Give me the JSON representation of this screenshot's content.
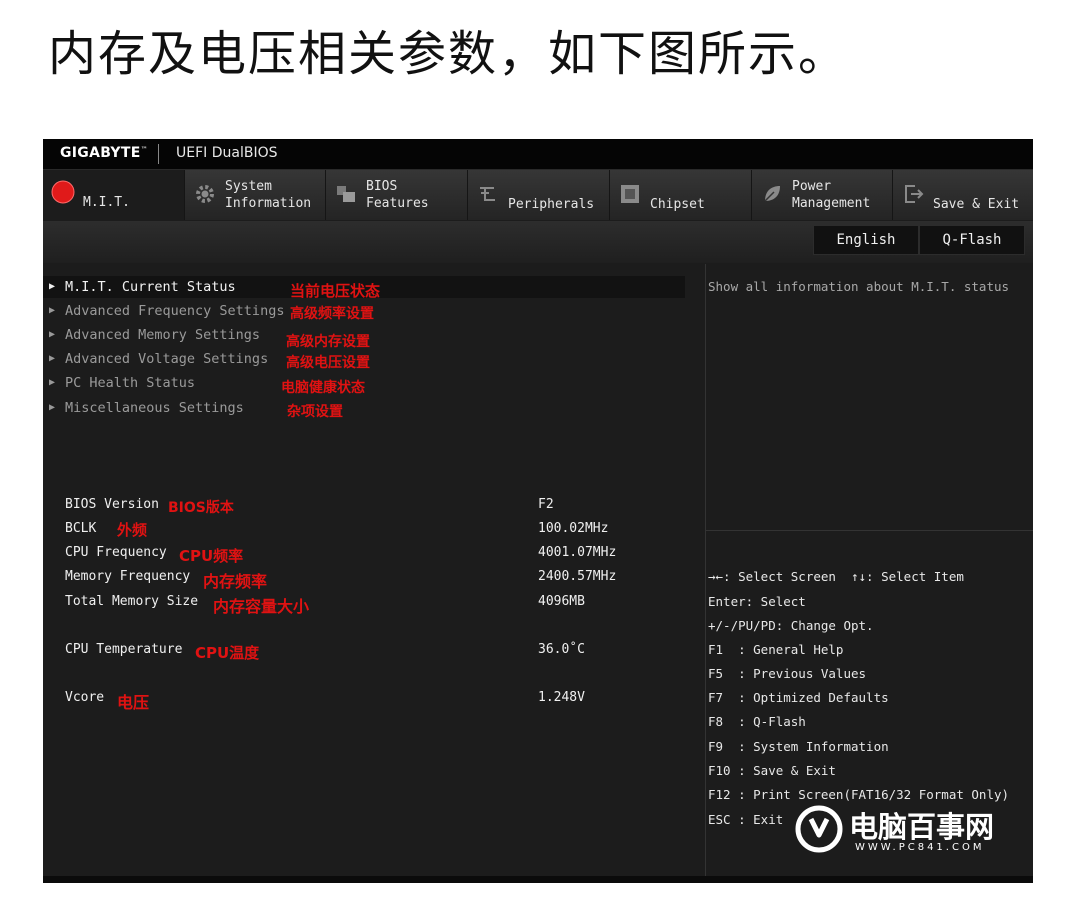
{
  "heading": "内存及电压相关参数，如下图所示。",
  "bios": {
    "brand": "GIGABYTE",
    "brand_mark": "™",
    "product": "UEFI DualBIOS",
    "tabs": [
      {
        "label": "M.I.T.",
        "icon": "mit-dot-icon",
        "active": true
      },
      {
        "label": "System\nInformation",
        "icon": "gear-icon"
      },
      {
        "label": "BIOS\nFeatures",
        "icon": "bios-features-icon"
      },
      {
        "label": "Peripherals",
        "icon": "peripherals-icon"
      },
      {
        "label": "Chipset",
        "icon": "chip-icon"
      },
      {
        "label": "Power\nManagement",
        "icon": "power-leaf-icon"
      },
      {
        "label": "Save & Exit",
        "icon": "exit-door-icon"
      }
    ],
    "language_button": "English",
    "qflash_button": "Q-Flash",
    "menu": [
      {
        "label": "M.I.T. Current Status",
        "annotation": "当前电压状态"
      },
      {
        "label": "Advanced Frequency Settings",
        "annotation": "高级频率设置"
      },
      {
        "label": "Advanced Memory Settings",
        "annotation": "高级内存设置"
      },
      {
        "label": "Advanced Voltage Settings",
        "annotation": "高级电压设置"
      },
      {
        "label": "PC Health Status",
        "annotation": "电脑健康状态"
      },
      {
        "label": "Miscellaneous Settings",
        "annotation": "杂项设置"
      }
    ],
    "status_rows": [
      {
        "label": "BIOS Version",
        "annotation": "BIOS版本",
        "value": "F2"
      },
      {
        "label": "BCLK",
        "annotation": "外频",
        "value": "100.02MHz"
      },
      {
        "label": "CPU Frequency",
        "annotation": "CPU频率",
        "value": "4001.07MHz"
      },
      {
        "label": "Memory Frequency",
        "annotation": "内存频率",
        "value": "2400.57MHz"
      },
      {
        "label": "Total Memory Size",
        "annotation": "内存容量大小",
        "value": "4096MB"
      },
      {
        "label": "CPU Temperature",
        "annotation": "CPU温度",
        "value": "36.0˚C"
      },
      {
        "label": "Vcore",
        "annotation": "电压",
        "value": "1.248V"
      }
    ],
    "help_text": "Show all information about M.I.T. status",
    "key_help": [
      "→←: Select Screen  ↑↓: Select Item",
      "Enter: Select",
      "+/-/PU/PD: Change Opt.",
      "F1  : General Help",
      "F5  : Previous Values",
      "F7  : Optimized Defaults",
      "F8  : Q-Flash",
      "F9  : System Information",
      "F10 : Save & Exit",
      "F12 : Print Screen(FAT16/32 Format Only)",
      "ESC : Exit"
    ]
  },
  "watermark": {
    "title": "电脑百事网",
    "url": "WWW.PC841.COM"
  }
}
